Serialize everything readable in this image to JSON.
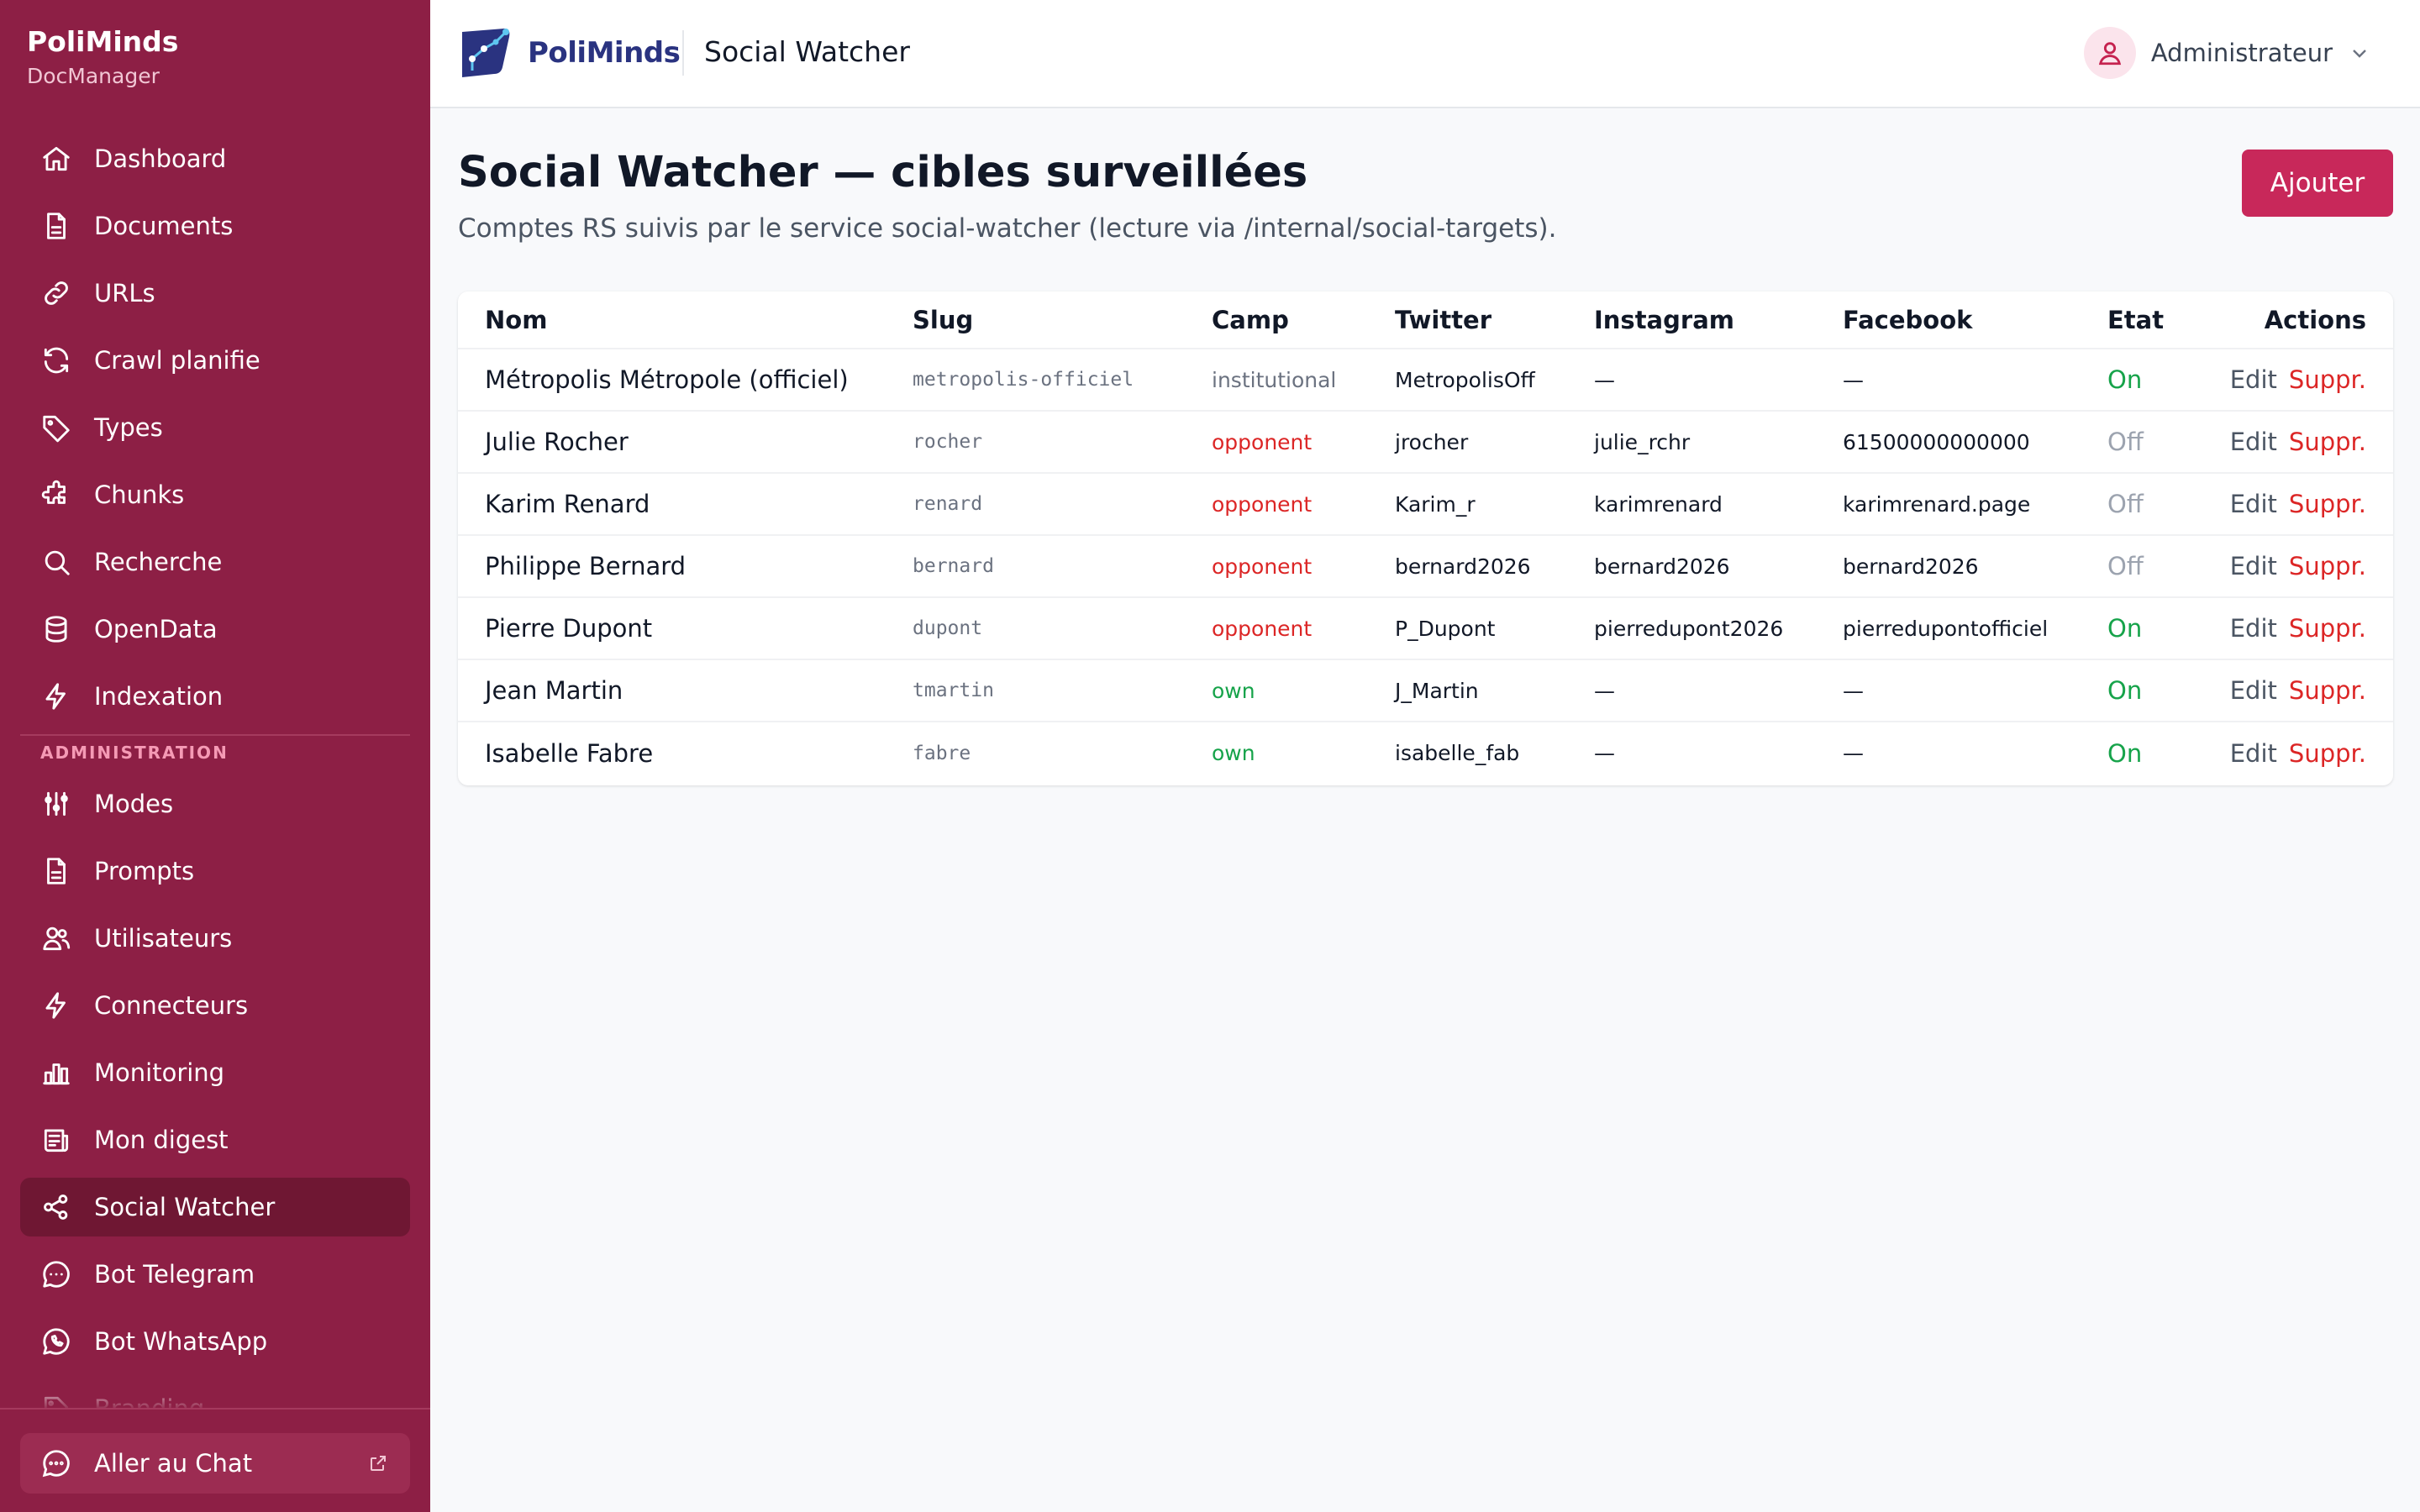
{
  "sidebar": {
    "brand_name": "PoliMinds",
    "brand_sub": "DocManager",
    "items": [
      {
        "label": "Dashboard",
        "icon": "home-icon"
      },
      {
        "label": "Documents",
        "icon": "document-icon"
      },
      {
        "label": "URLs",
        "icon": "link-icon"
      },
      {
        "label": "Crawl planifie",
        "icon": "refresh-icon"
      },
      {
        "label": "Types",
        "icon": "tag-icon"
      },
      {
        "label": "Chunks",
        "icon": "puzzle-icon"
      },
      {
        "label": "Recherche",
        "icon": "search-icon"
      },
      {
        "label": "OpenData",
        "icon": "database-icon"
      },
      {
        "label": "Indexation",
        "icon": "bolt-icon"
      }
    ],
    "admin_section_label": "ADMINISTRATION",
    "admin_items": [
      {
        "label": "Modes",
        "icon": "sliders-icon"
      },
      {
        "label": "Prompts",
        "icon": "document-icon"
      },
      {
        "label": "Utilisateurs",
        "icon": "users-icon"
      },
      {
        "label": "Connecteurs",
        "icon": "bolt-icon"
      },
      {
        "label": "Monitoring",
        "icon": "bar-chart-icon"
      },
      {
        "label": "Mon digest",
        "icon": "newspaper-icon"
      },
      {
        "label": "Social Watcher",
        "icon": "share-icon",
        "active": true
      },
      {
        "label": "Bot Telegram",
        "icon": "chat-bubble-icon"
      },
      {
        "label": "Bot WhatsApp",
        "icon": "whatsapp-icon"
      },
      {
        "label": "Branding",
        "icon": "palette-icon"
      }
    ],
    "footer_button": "Aller au Chat"
  },
  "topbar": {
    "logo_text": "PoliMinds",
    "title": "Social Watcher",
    "user_name": "Administrateur"
  },
  "main": {
    "title": "Social Watcher — cibles surveillées",
    "subtitle": "Comptes RS suivis par le service social-watcher (lecture via /internal/social-targets).",
    "add_button": "Ajouter",
    "table": {
      "columns": [
        "Nom",
        "Slug",
        "Camp",
        "Twitter",
        "Instagram",
        "Facebook",
        "Etat",
        "Actions"
      ],
      "edit_label": "Edit",
      "delete_label": "Suppr.",
      "rows": [
        {
          "nom": "Métropolis Métropole (officiel)",
          "slug": "metropolis-officiel",
          "camp": "institutional",
          "twitter": "MetropolisOff",
          "instagram": "—",
          "facebook": "—",
          "etat": "On"
        },
        {
          "nom": "Julie Rocher",
          "slug": "rocher",
          "camp": "opponent",
          "twitter": "jrocher",
          "instagram": "julie_rchr",
          "facebook": "61500000000000",
          "etat": "Off"
        },
        {
          "nom": "Karim Renard",
          "slug": "renard",
          "camp": "opponent",
          "twitter": "Karim_r",
          "instagram": "karimrenard",
          "facebook": "karimrenard.page",
          "etat": "Off"
        },
        {
          "nom": "Philippe Bernard",
          "slug": "bernard",
          "camp": "opponent",
          "twitter": "bernard2026",
          "instagram": "bernard2026",
          "facebook": "bernard2026",
          "etat": "Off"
        },
        {
          "nom": "Pierre Dupont",
          "slug": "dupont",
          "camp": "opponent",
          "twitter": "P_Dupont",
          "instagram": "pierredupont2026",
          "facebook": "pierredupontofficiel",
          "etat": "On"
        },
        {
          "nom": "Jean Martin",
          "slug": "tmartin",
          "camp": "own",
          "twitter": "J_Martin",
          "instagram": "—",
          "facebook": "—",
          "etat": "On"
        },
        {
          "nom": "Isabelle Fabre",
          "slug": "fabre",
          "camp": "own",
          "twitter": "isabelle_fab",
          "instagram": "—",
          "facebook": "—",
          "etat": "On"
        }
      ]
    }
  },
  "colors": {
    "sidebar_bg": "#8d1f45",
    "sidebar_active": "#6f1733",
    "accent": "#c8285a",
    "on": "#16a34a",
    "off": "#9ca3af",
    "opponent": "#dc2626",
    "own": "#16a34a"
  }
}
